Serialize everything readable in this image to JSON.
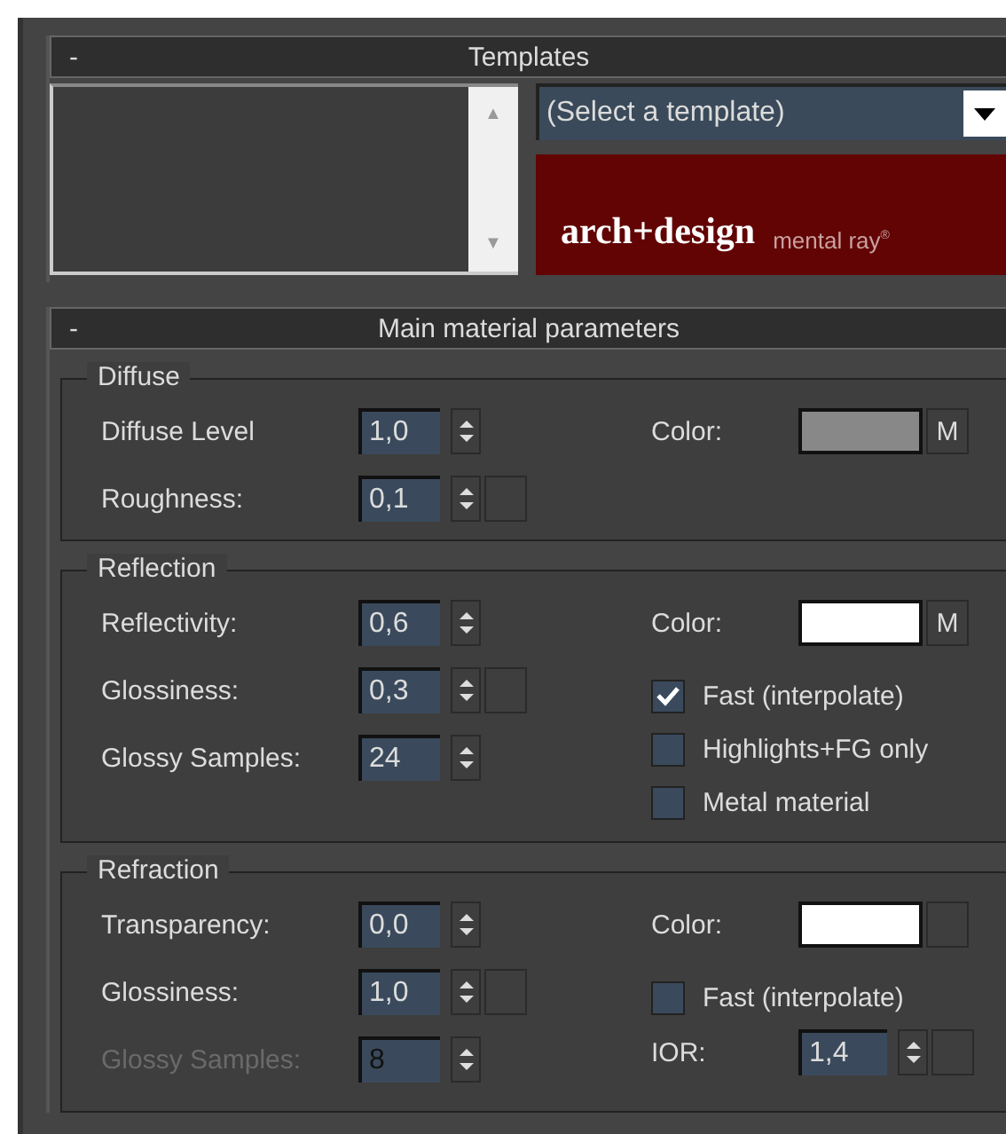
{
  "rollouts": [
    {
      "title": "Templates",
      "collapse_label": "-",
      "kind": "templates",
      "list_box": {
        "scroll_up": "▲",
        "scroll_down": "▼"
      },
      "dropdown": {
        "value": "(Select a template)"
      },
      "logo": {
        "name": "arch+design",
        "brand": "mental ray",
        "mark": "®"
      }
    },
    {
      "title": "Main material parameters",
      "collapse_label": "-",
      "kind": "params",
      "groups": [
        {
          "title": "Diffuse",
          "left": [
            {
              "label": "Diffuse Level",
              "value": "1,0",
              "disabled": false,
              "map_button": false
            },
            {
              "label": "Roughness:",
              "value": "0,1",
              "disabled": false,
              "map_button": true
            }
          ],
          "right": [
            {
              "kind": "color",
              "label": "Color:",
              "color": "#888888",
              "map_label": "M"
            }
          ]
        },
        {
          "title": "Reflection",
          "left": [
            {
              "label": "Reflectivity:",
              "value": "0,6",
              "disabled": false,
              "map_button": false
            },
            {
              "label": "Glossiness:",
              "value": "0,3",
              "disabled": false,
              "map_button": true
            },
            {
              "label": "Glossy Samples:",
              "value": "24",
              "disabled": false,
              "map_button": false
            }
          ],
          "right": [
            {
              "kind": "color",
              "label": "Color:",
              "color": "#ffffff",
              "map_label": "M"
            },
            {
              "kind": "checkbox",
              "label": "Fast (interpolate)",
              "checked": true
            },
            {
              "kind": "checkbox",
              "label": "Highlights+FG only",
              "checked": false
            },
            {
              "kind": "checkbox",
              "label": "Metal material",
              "checked": false
            }
          ]
        },
        {
          "title": "Refraction",
          "left": [
            {
              "label": "Transparency:",
              "value": "0,0",
              "disabled": false,
              "map_button": false
            },
            {
              "label": "Glossiness:",
              "value": "1,0",
              "disabled": false,
              "map_button": true
            },
            {
              "label": "Glossy Samples:",
              "value": "8",
              "disabled": true,
              "map_button": false
            }
          ],
          "right": [
            {
              "kind": "color",
              "label": "Color:",
              "color": "#ffffff"
            },
            {
              "kind": "checkbox",
              "label": "Fast (interpolate)",
              "checked": false
            },
            {
              "kind": "spinner",
              "label": "IOR:",
              "value": "1,4",
              "map_button": true
            }
          ]
        }
      ]
    }
  ]
}
